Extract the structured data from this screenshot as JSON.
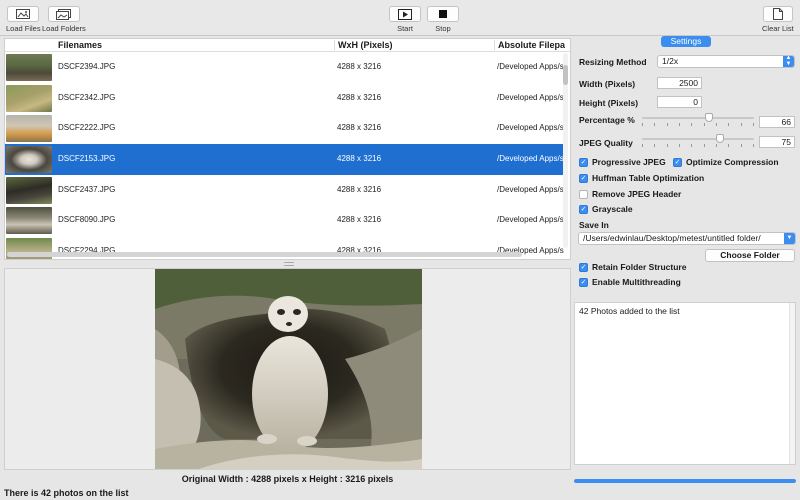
{
  "toolbar": {
    "load_files": "Load Files",
    "load_folders": "Load Folders",
    "start": "Start",
    "stop": "Stop",
    "clear_list": "Clear List"
  },
  "table": {
    "headers": {
      "filenames": "Filenames",
      "wxh": "WxH (Pixels)",
      "path": "Absolute Filepa"
    },
    "rows": [
      {
        "name": "DSCF2394.JPG",
        "size": "4288 x 3216",
        "path": "/Developed Apps/s"
      },
      {
        "name": "DSCF2342.JPG",
        "size": "4288 x 3216",
        "path": "/Developed Apps/s"
      },
      {
        "name": "DSCF2222.JPG",
        "size": "4288 x 3216",
        "path": "/Developed Apps/s"
      },
      {
        "name": "DSCF2153.JPG",
        "size": "4288 x 3216",
        "path": "/Developed Apps/s"
      },
      {
        "name": "DSCF2437.JPG",
        "size": "4288 x 3216",
        "path": "/Developed Apps/s"
      },
      {
        "name": "DSCF8090.JPG",
        "size": "4288 x 3216",
        "path": "/Developed Apps/s"
      },
      {
        "name": "DSCF2294.JPG",
        "size": "4288 x 3216",
        "path": "/Developed Apps/s"
      }
    ],
    "selected_index": 3
  },
  "preview": {
    "original_size": "Original Width : 4288 pixels x Height : 3216 pixels"
  },
  "status": "There is 42 photos on the list",
  "settings": {
    "tab": "Settings",
    "resizing_method_label": "Resizing Method",
    "resizing_method_value": "1/2x",
    "width_label": "Width (Pixels)",
    "width_value": "2500",
    "height_label": "Height (Pixels)",
    "height_value": "0",
    "percentage_label": "Percentage %",
    "percentage_value": "66",
    "jpeg_quality_label": "JPEG Quality",
    "jpeg_quality_value": "75",
    "progressive_jpeg": "Progressive JPEG",
    "optimize_compression": "Optimize Compression",
    "huffman": "Huffman Table Optimization",
    "remove_header": "Remove JPEG Header",
    "grayscale": "Grayscale",
    "save_in_label": "Save In",
    "save_in_value": "/Users/edwinlau/Desktop/metest/untitled folder/",
    "choose_folder": "Choose Folder",
    "retain_structure": "Retain Folder Structure",
    "multithreading": "Enable Multithreading"
  },
  "log": {
    "message": "42 Photos added to the list"
  },
  "progress": {
    "fraction": 1.0
  },
  "colors": {
    "accent": "#3b8ef0",
    "selection": "#1f6fd1"
  }
}
